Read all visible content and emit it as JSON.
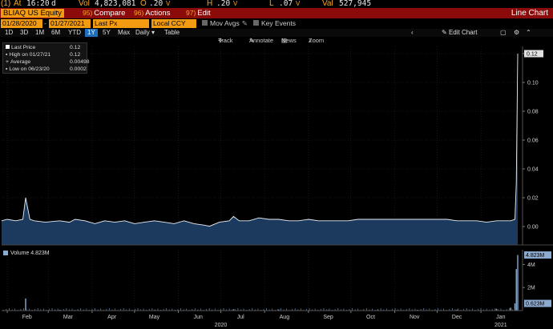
{
  "quote": {
    "ticker_badge": "(1)",
    "at_label": "At",
    "time": "16:20",
    "time_suffix": "d",
    "vol_label": "Vol",
    "vol": "4,823,081",
    "open_label": "O",
    "open": ".20",
    "open_suffix": "V",
    "high_label": "H",
    "high": ".20",
    "high_suffix": "V",
    "low_label": "L",
    "low": ".07",
    "low_suffix": "V",
    "val_label": "Val",
    "val": "527,945"
  },
  "title_bar": {
    "ticker": "BLIAQ US Equity",
    "compare_num": "95)",
    "compare": "Compare",
    "actions_num": "96)",
    "actions": "Actions",
    "edit_num": "97)",
    "edit": "Edit",
    "right_title": "Line Chart"
  },
  "params": {
    "start_date": "01/28/2020",
    "end_date": "01/27/2021",
    "field": "Last Px",
    "currency": "Local CCY",
    "mov_avgs": "Mov Avgs",
    "key_events": "Key Events"
  },
  "periods": [
    "1D",
    "3D",
    "1M",
    "6M",
    "YTD",
    "1Y",
    "5Y",
    "Max"
  ],
  "active_period": "1Y",
  "frequency": "Daily",
  "table": "Table",
  "edit_chart": "Edit Chart",
  "tools": {
    "track": "Track",
    "annotate": "Annotate",
    "news": "News",
    "zoom": "Zoom"
  },
  "legend": {
    "last_price_label": "Last Price",
    "last_price": "0.12",
    "high_label": "High on 01/27/21",
    "high": "0.12",
    "average_label": "Average",
    "average": "0.00498",
    "low_label": "Low on 06/23/20",
    "low": "0.0002"
  },
  "volume_legend": "Volume 4.823M",
  "colors": {
    "area_fill": "#1c3a5e",
    "line": "#e8eef5",
    "volume_bar": "#8aaad0",
    "accent_orange": "#f39c12",
    "title_red": "#8b0b0b",
    "active_blue": "#1f6fbd"
  },
  "chart_data": [
    {
      "type": "area",
      "y_ticks": [
        "0.12",
        "0.10",
        "0.08",
        "0.06",
        "0.04",
        "0.02",
        "0.00"
      ],
      "ylim": [
        0,
        0.12
      ],
      "last_value_label": "0.12",
      "x_ticks": [
        "Feb",
        "Mar",
        "Apr",
        "May",
        "Jun",
        "Jul",
        "Aug",
        "Sep",
        "Oct",
        "Nov",
        "Dec",
        "Jan"
      ],
      "year_labels": [
        "2020",
        "2021"
      ],
      "series": [
        {
          "name": "Last Price",
          "x": [
            "2020-01-28",
            "2020-02-01",
            "2020-02-07",
            "2020-02-12",
            "2020-02-14",
            "2020-02-17",
            "2020-02-20",
            "2020-02-28",
            "2020-03-09",
            "2020-03-16",
            "2020-03-20",
            "2020-03-27",
            "2020-04-03",
            "2020-04-10",
            "2020-04-17",
            "2020-04-24",
            "2020-05-01",
            "2020-05-08",
            "2020-05-15",
            "2020-05-22",
            "2020-05-29",
            "2020-06-05",
            "2020-06-12",
            "2020-06-19",
            "2020-06-23",
            "2020-06-30",
            "2020-07-07",
            "2020-07-10",
            "2020-07-14",
            "2020-07-21",
            "2020-07-28",
            "2020-08-04",
            "2020-08-11",
            "2020-08-18",
            "2020-08-25",
            "2020-09-01",
            "2020-09-08",
            "2020-09-15",
            "2020-09-22",
            "2020-09-29",
            "2020-10-06",
            "2020-10-13",
            "2020-10-20",
            "2020-10-27",
            "2020-11-03",
            "2020-11-10",
            "2020-11-17",
            "2020-11-24",
            "2020-12-01",
            "2020-12-08",
            "2020-12-15",
            "2020-12-22",
            "2020-12-29",
            "2021-01-05",
            "2021-01-12",
            "2021-01-19",
            "2021-01-22",
            "2021-01-25",
            "2021-01-26",
            "2021-01-27"
          ],
          "values": [
            0.004,
            0.005,
            0.004,
            0.005,
            0.02,
            0.005,
            0.004,
            0.003,
            0.004,
            0.003,
            0.005,
            0.004,
            0.002,
            0.004,
            0.003,
            0.004,
            0.002,
            0.003,
            0.004,
            0.003,
            0.002,
            0.004,
            0.002,
            0.001,
            0.0002,
            0.003,
            0.004,
            0.007,
            0.004,
            0.004,
            0.006,
            0.005,
            0.005,
            0.004,
            0.004,
            0.005,
            0.004,
            0.004,
            0.004,
            0.004,
            0.005,
            0.005,
            0.005,
            0.005,
            0.005,
            0.005,
            0.005,
            0.005,
            0.005,
            0.005,
            0.004,
            0.004,
            0.004,
            0.003,
            0.004,
            0.004,
            0.004,
            0.005,
            0.03,
            0.12
          ]
        }
      ]
    },
    {
      "type": "bar",
      "y_ticks": [
        "4M",
        "2M"
      ],
      "last_value_label": "4.823M",
      "secondary_value_label": "0.623M",
      "ylim": [
        0,
        5000000
      ],
      "series": [
        {
          "name": "Volume",
          "x": [
            "2020-02-14",
            "2020-03-09",
            "2020-04-03",
            "2020-05-15",
            "2020-06-12",
            "2020-07-10",
            "2020-08-11",
            "2020-09-15",
            "2020-10-20",
            "2020-11-17",
            "2020-12-15",
            "2021-01-12",
            "2021-01-22",
            "2021-01-25",
            "2021-01-26",
            "2021-01-27"
          ],
          "values": [
            1050000,
            60000,
            40000,
            50000,
            40000,
            120000,
            90000,
            50000,
            70000,
            60000,
            80000,
            150000,
            250000,
            623000,
            3600000,
            4823081
          ]
        }
      ]
    }
  ]
}
